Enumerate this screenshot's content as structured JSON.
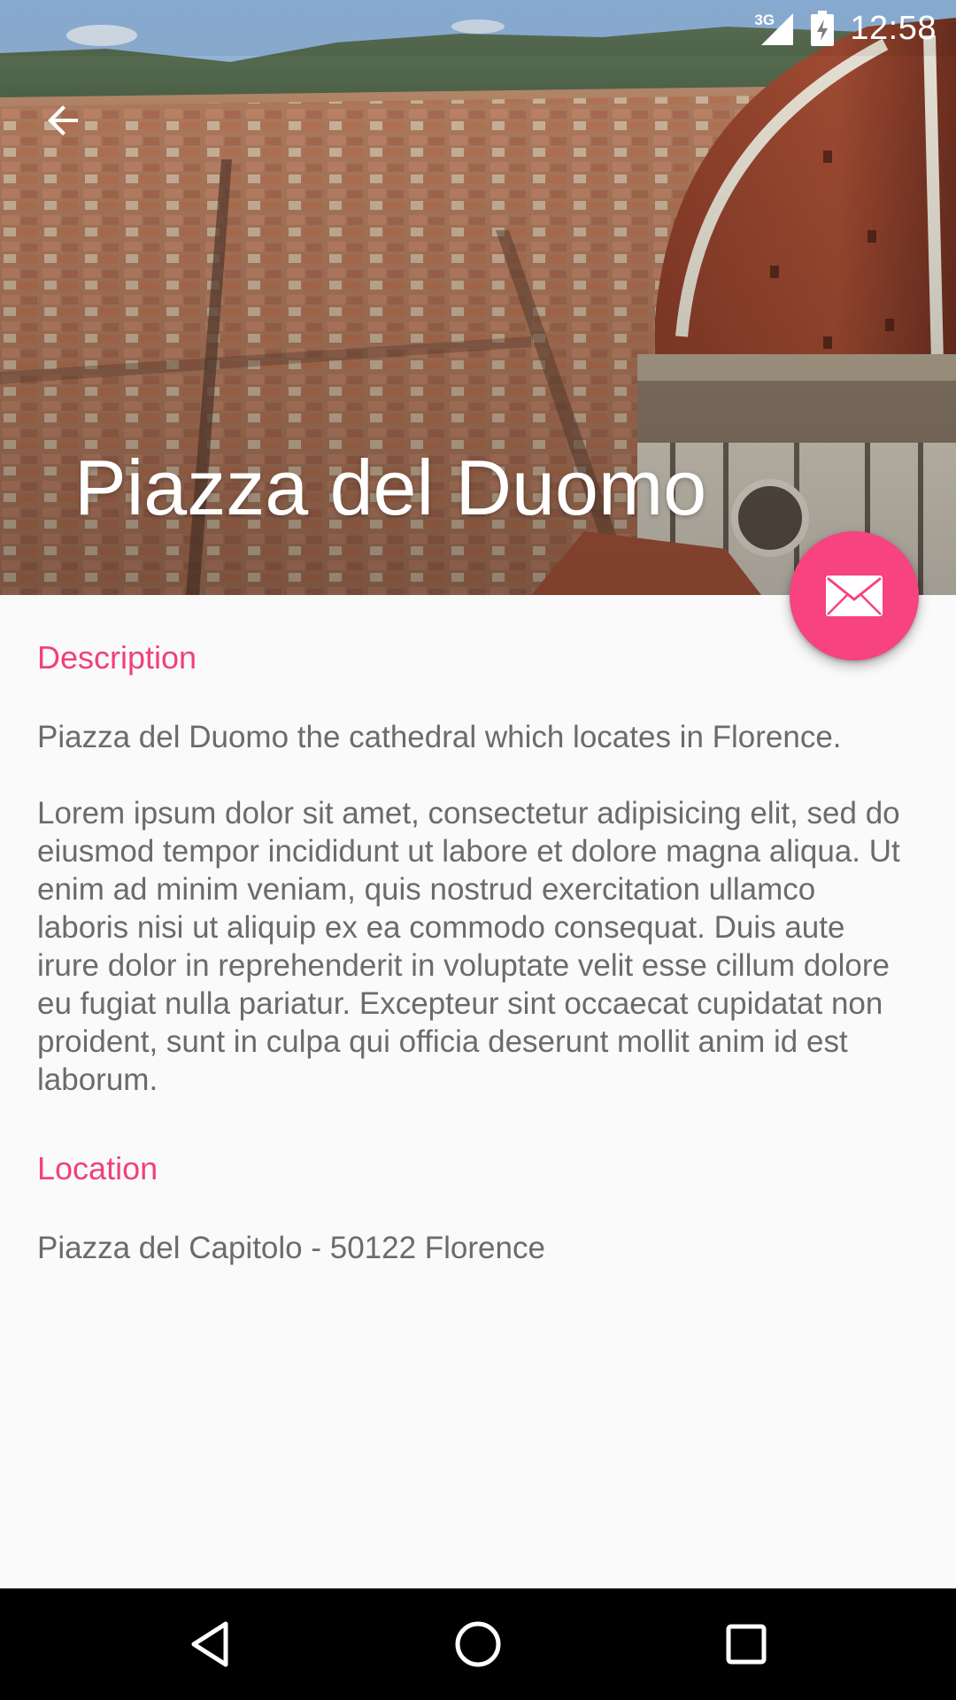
{
  "status_bar": {
    "network_type": "3G",
    "time": "12:58",
    "icons": [
      "signal-icon",
      "battery-charging-icon"
    ]
  },
  "toolbar": {
    "back_icon": "arrow-back-icon"
  },
  "hero": {
    "title": "Piazza del Duomo"
  },
  "fab": {
    "icon": "mail-icon",
    "color": "#f7437f"
  },
  "description": {
    "heading": "Description",
    "summary": "Piazza del Duomo the cathedral which locates in Florence.",
    "body": "Lorem ipsum dolor sit amet, consectetur adipisicing elit, sed do eiusmod tempor incididunt ut labore et dolore magna aliqua. Ut enim ad minim veniam, quis nostrud exercitation ullamco laboris nisi ut aliquip ex ea commodo consequat. Duis aute irure dolor in reprehenderit in voluptate velit esse cillum dolore eu fugiat nulla pariatur. Excepteur sint occaecat cupidatat non proident, sunt in culpa qui officia deserunt mollit anim id est laborum."
  },
  "location": {
    "heading": "Location",
    "address": "Piazza del Capitolo - 50122 Florence"
  },
  "navigation_bar": {
    "icons": [
      "nav-back-icon",
      "nav-home-icon",
      "nav-recents-icon"
    ]
  },
  "colors": {
    "accent": "#f1407c",
    "body_text": "#6b6b6b",
    "background": "#fafafa",
    "nav_bar": "#000000"
  }
}
